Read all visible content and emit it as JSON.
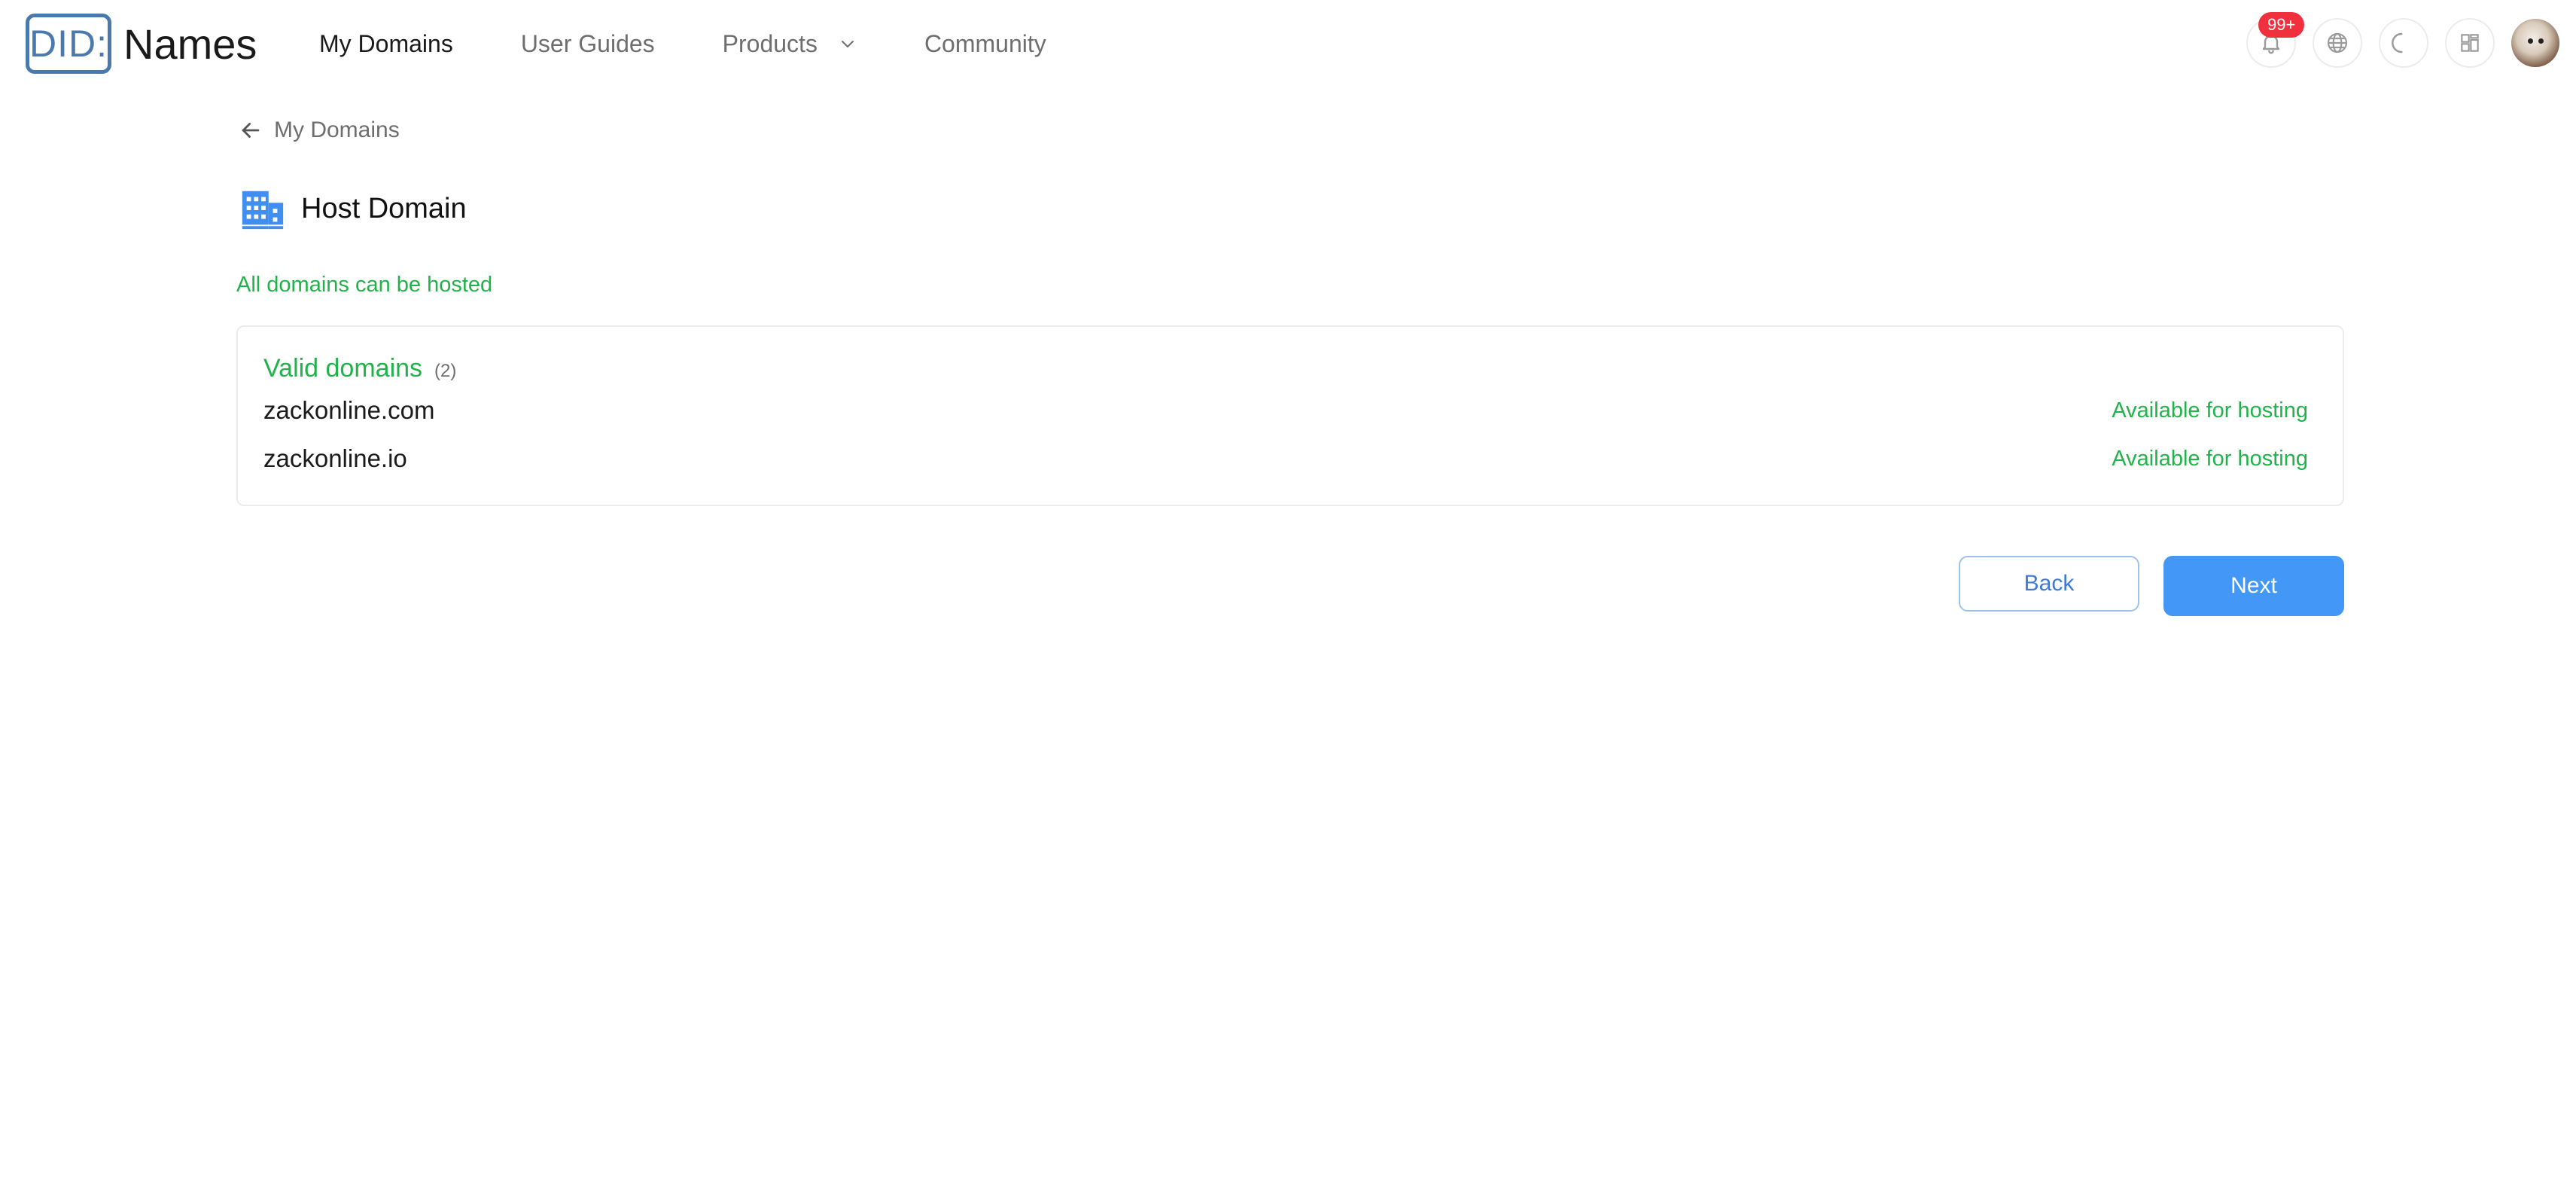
{
  "header": {
    "logo_mark": "DID:",
    "logo_text": "Names",
    "nav": {
      "my_domains": "My Domains",
      "user_guides": "User Guides",
      "products": "Products",
      "community": "Community"
    },
    "notification_badge": "99+"
  },
  "breadcrumb": {
    "back_label": "My Domains"
  },
  "page": {
    "title": "Host Domain",
    "status_message": "All domains can be hosted"
  },
  "valid_domains": {
    "title": "Valid domains",
    "count": "(2)",
    "items": [
      {
        "name": "zackonline.com",
        "status": "Available for hosting"
      },
      {
        "name": "zackonline.io",
        "status": "Available for hosting"
      }
    ]
  },
  "actions": {
    "back_label": "Back",
    "next_label": "Next"
  },
  "colors": {
    "brand_logo": "#4a79ad",
    "success_green": "#21b24b",
    "primary_blue": "#4398f7",
    "badge_red": "#f0303c"
  },
  "icons": {
    "bell": "bell-icon",
    "globe": "globe-icon",
    "theme": "moon-icon",
    "apps": "apps-grid-icon",
    "back": "arrow-left-icon",
    "page": "building-icon",
    "dropdown": "chevron-down-icon"
  }
}
